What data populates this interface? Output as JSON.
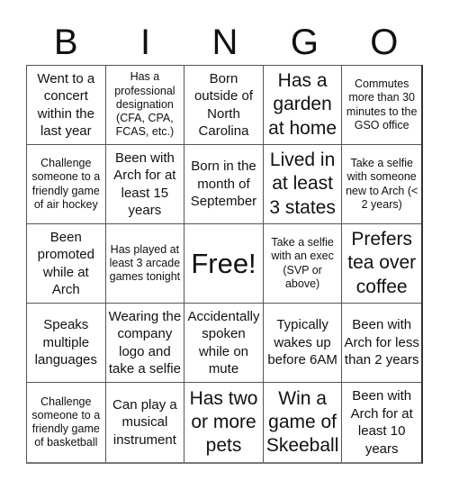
{
  "header": {
    "letters": [
      "B",
      "I",
      "N",
      "G",
      "O"
    ]
  },
  "cells": [
    {
      "text": "Went to a concert within the last year",
      "size": "m"
    },
    {
      "text": "Has a professional designation (CFA, CPA, FCAS, etc.)",
      "size": "s"
    },
    {
      "text": "Born outside of North Carolina",
      "size": "m"
    },
    {
      "text": "Has a garden at home",
      "size": "xl"
    },
    {
      "text": "Commutes more than 30 minutes to the GSO office",
      "size": "s"
    },
    {
      "text": "Challenge someone to a friendly game of air hockey",
      "size": "s"
    },
    {
      "text": "Been with Arch for at least 15 years",
      "size": "m"
    },
    {
      "text": "Born in the month of September",
      "size": "m"
    },
    {
      "text": "Lived in at least 3 states",
      "size": "xl"
    },
    {
      "text": "Take a selfie with someone new to Arch (< 2 years)",
      "size": "s"
    },
    {
      "text": "Been promoted while at Arch",
      "size": "m"
    },
    {
      "text": "Has played at least 3 arcade games tonight",
      "size": "s"
    },
    {
      "text": "Free!",
      "size": "free"
    },
    {
      "text": "Take a selfie with an exec (SVP or above)",
      "size": "s"
    },
    {
      "text": "Prefers tea over coffee",
      "size": "xl"
    },
    {
      "text": "Speaks multiple languages",
      "size": "m"
    },
    {
      "text": "Wearing the company logo and take a selfie",
      "size": "m"
    },
    {
      "text": "Accidentally spoken while on mute",
      "size": "m"
    },
    {
      "text": "Typically wakes up before 6AM",
      "size": "m"
    },
    {
      "text": "Been with Arch for less than 2 years",
      "size": "m"
    },
    {
      "text": "Challenge someone to a friendly game of basketball",
      "size": "s"
    },
    {
      "text": "Can play a musical instrument",
      "size": "m"
    },
    {
      "text": "Has two or more pets",
      "size": "xl"
    },
    {
      "text": "Win a game of Skeeball",
      "size": "xl"
    },
    {
      "text": "Been with Arch for at least 10 years",
      "size": "m"
    }
  ]
}
